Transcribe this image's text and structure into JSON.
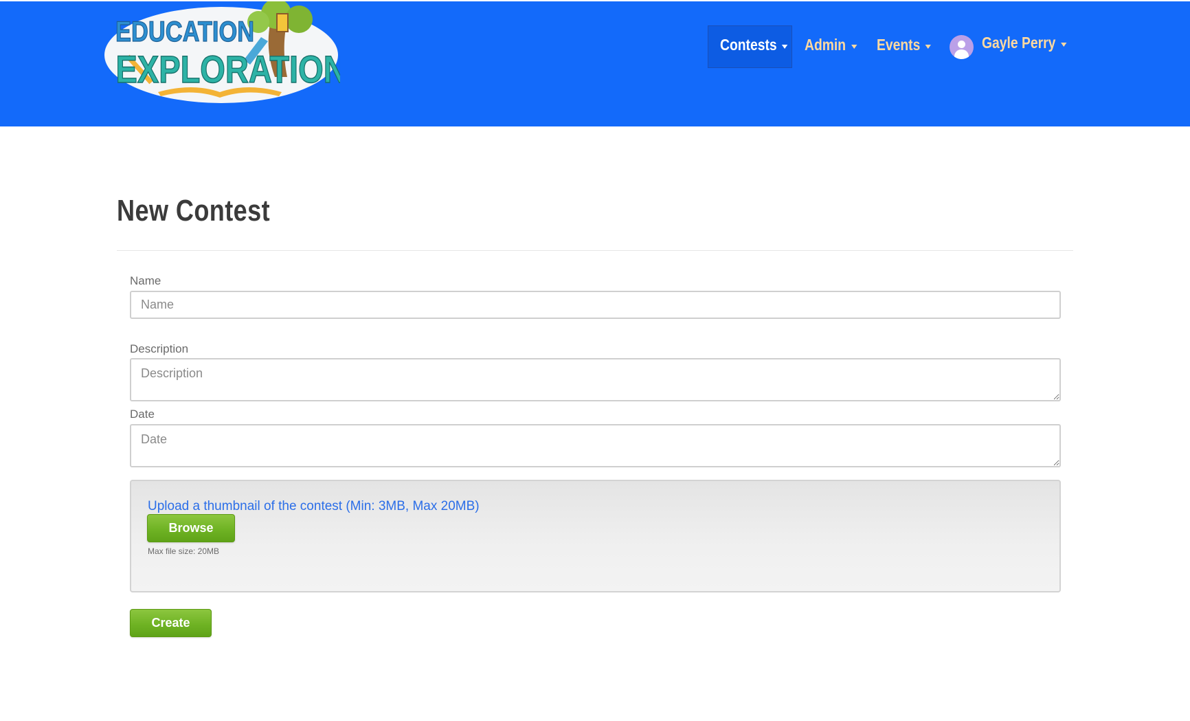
{
  "header": {
    "logo": {
      "line1": "EDUCATION",
      "line2": "EXPLORATIONS"
    },
    "nav": {
      "contests": "Contests",
      "admin": "Admin",
      "events": "Events",
      "user": "Gayle Perry"
    },
    "active_nav": "Contests"
  },
  "page": {
    "title": "New Contest"
  },
  "form": {
    "name": {
      "label": "Name",
      "placeholder": "Name",
      "value": ""
    },
    "description": {
      "label": "Description",
      "placeholder": "Description",
      "value": ""
    },
    "date": {
      "label": "Date",
      "placeholder": "Date",
      "value": ""
    },
    "upload": {
      "prompt": "Upload a thumbnail of the contest (Min: 3MB, Max 20MB)",
      "browse_label": "Browse",
      "max_size": "Max file size: 20MB"
    },
    "create_label": "Create"
  },
  "colors": {
    "header_bg": "#136afa",
    "nav_active_bg": "#0d5ce3",
    "nav_text": "#ffd9a0",
    "link_blue": "#2b6ee8",
    "button_green": "#6fb324"
  }
}
